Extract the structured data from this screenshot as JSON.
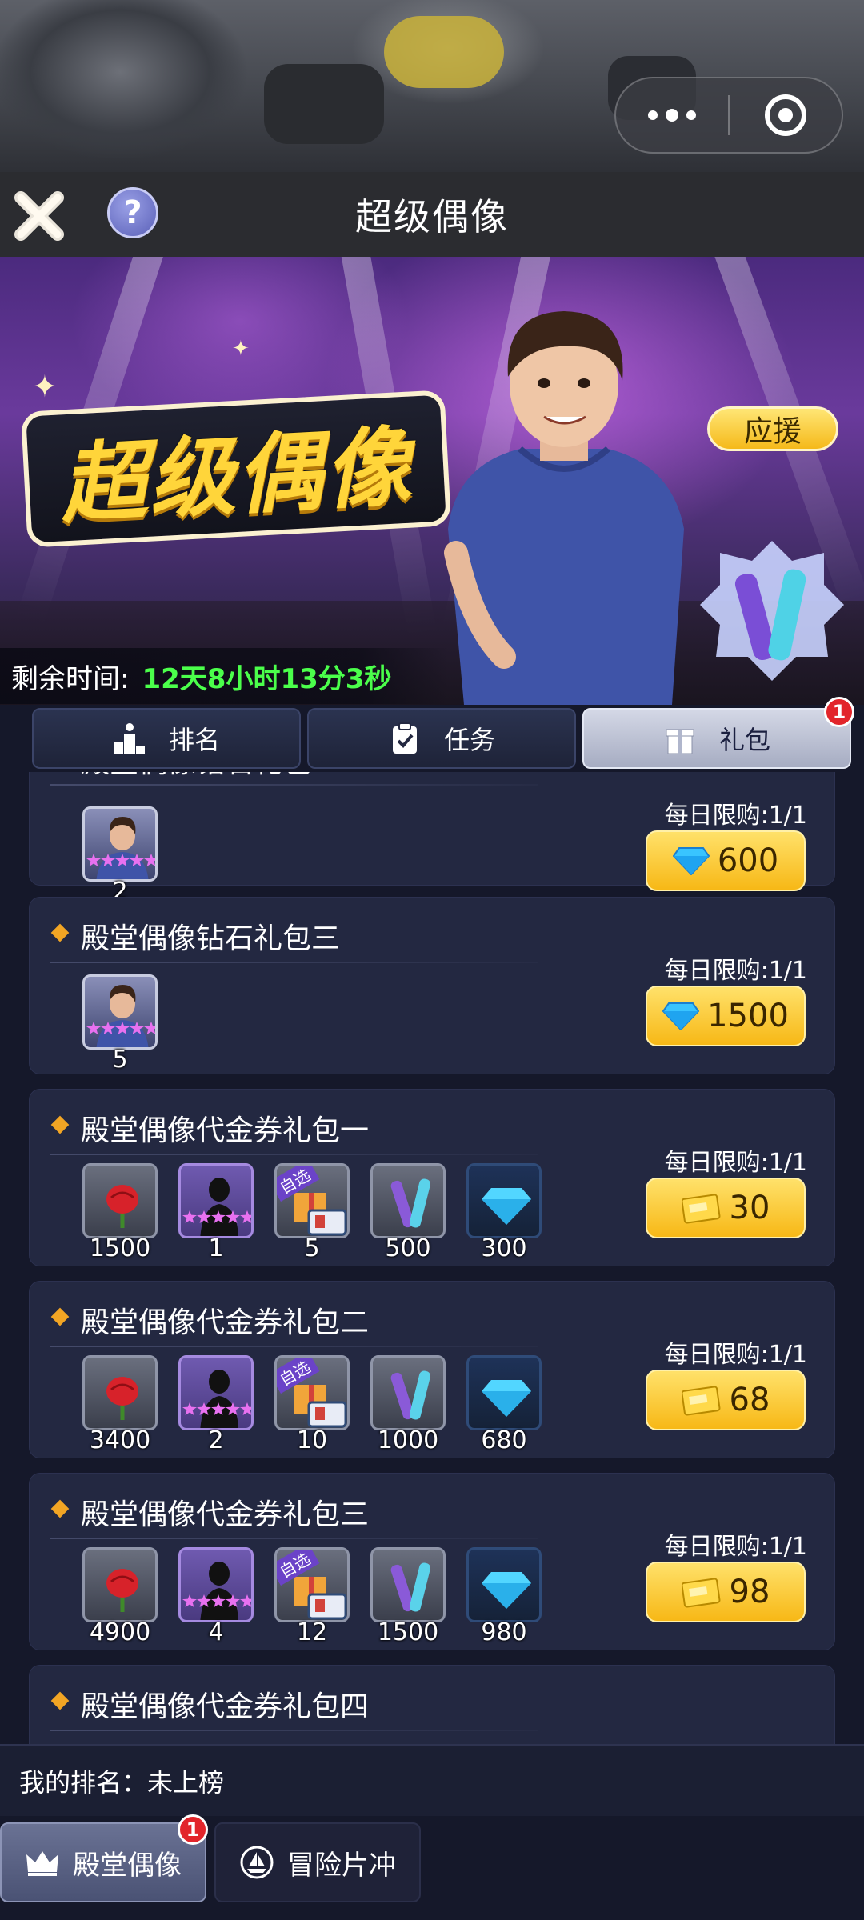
{
  "header": {
    "title": "超级偶像"
  },
  "banner": {
    "logo_text": "超级偶像",
    "time_label": "剩余时间:",
    "time_value": "12天8小时13分3秒",
    "cheer_label": "应援"
  },
  "tabs": [
    {
      "label": "排名",
      "icon": "podium-icon"
    },
    {
      "label": "任务",
      "icon": "clipboard-check-icon"
    },
    {
      "label": "礼包",
      "icon": "gift-icon",
      "badge": "1",
      "active": true
    }
  ],
  "packs": [
    {
      "name": "殿堂偶像钻石礼包二",
      "limit": "每日限购:1/1",
      "price": "600",
      "currency": "diamond-icon",
      "items": [
        {
          "type": "idol-card",
          "qty": "2"
        }
      ]
    },
    {
      "name": "殿堂偶像钻石礼包三",
      "limit": "每日限购:1/1",
      "price": "1500",
      "currency": "diamond-icon",
      "items": [
        {
          "type": "idol-card",
          "qty": "5"
        }
      ]
    },
    {
      "name": "殿堂偶像代金券礼包一",
      "limit": "每日限购:1/1",
      "price": "30",
      "currency": "voucher-icon",
      "items": [
        {
          "type": "rose",
          "qty": "1500"
        },
        {
          "type": "silhouette-card",
          "qty": "1"
        },
        {
          "type": "optional-gift",
          "qty": "5",
          "tag": "自选"
        },
        {
          "type": "glow-stick",
          "qty": "500"
        },
        {
          "type": "diamond",
          "qty": "300"
        }
      ]
    },
    {
      "name": "殿堂偶像代金券礼包二",
      "limit": "每日限购:1/1",
      "price": "68",
      "currency": "voucher-icon",
      "items": [
        {
          "type": "rose",
          "qty": "3400"
        },
        {
          "type": "silhouette-card",
          "qty": "2"
        },
        {
          "type": "optional-gift",
          "qty": "10",
          "tag": "自选"
        },
        {
          "type": "glow-stick",
          "qty": "1000"
        },
        {
          "type": "diamond",
          "qty": "680"
        }
      ]
    },
    {
      "name": "殿堂偶像代金券礼包三",
      "limit": "每日限购:1/1",
      "price": "98",
      "currency": "voucher-icon",
      "items": [
        {
          "type": "rose",
          "qty": "4900"
        },
        {
          "type": "silhouette-card",
          "qty": "4"
        },
        {
          "type": "optional-gift",
          "qty": "12",
          "tag": "自选"
        },
        {
          "type": "glow-stick",
          "qty": "1500"
        },
        {
          "type": "diamond",
          "qty": "980"
        }
      ]
    },
    {
      "name": "殿堂偶像代金券礼包四"
    }
  ],
  "footer": {
    "my_rank_label": "我的排名：",
    "my_rank_value": "未上榜",
    "bottom_tabs": [
      {
        "label": "殿堂偶像",
        "icon": "crown-icon",
        "badge": "1",
        "active": true
      },
      {
        "label": "冒险片冲",
        "icon": "sailboat-icon"
      }
    ]
  },
  "colors": {
    "accent_gold": "#f7b816",
    "timer_green": "#4bff4b",
    "badge_red": "#e2252b",
    "card_bg": "#232841"
  }
}
